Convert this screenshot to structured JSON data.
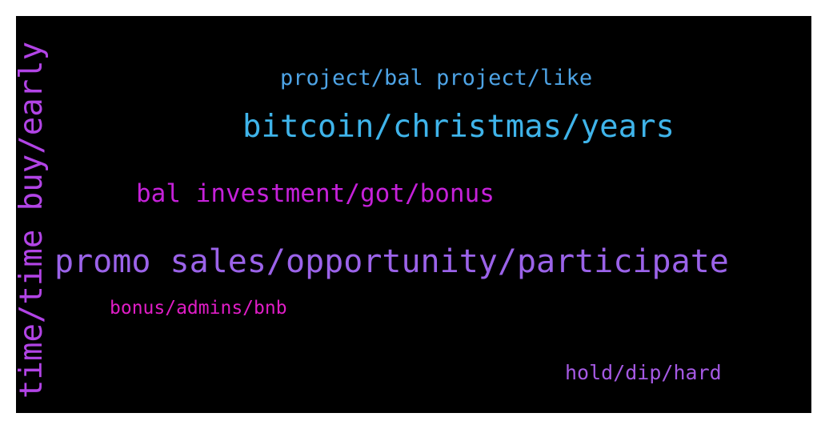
{
  "colors": {
    "background": "#000000",
    "border": "#ffffff"
  },
  "words": [
    {
      "id": "w-project",
      "text": "project/bal project/like",
      "color": "#4ea4e6"
    },
    {
      "id": "w-bitcoin",
      "text": "bitcoin/christmas/years",
      "color": "#3fb4ea"
    },
    {
      "id": "w-bal",
      "text": "bal investment/got/bonus",
      "color": "#c521d9"
    },
    {
      "id": "w-promo",
      "text": "promo sales/opportunity/participate",
      "color": "#9b63e9"
    },
    {
      "id": "w-bonus",
      "text": "bonus/admins/bnb",
      "color": "#e01dc6"
    },
    {
      "id": "w-hold",
      "text": "hold/dip/hard",
      "color": "#a559e3"
    },
    {
      "id": "w-vertical",
      "text": "time/time buy/early",
      "color": "#b244e6"
    }
  ]
}
